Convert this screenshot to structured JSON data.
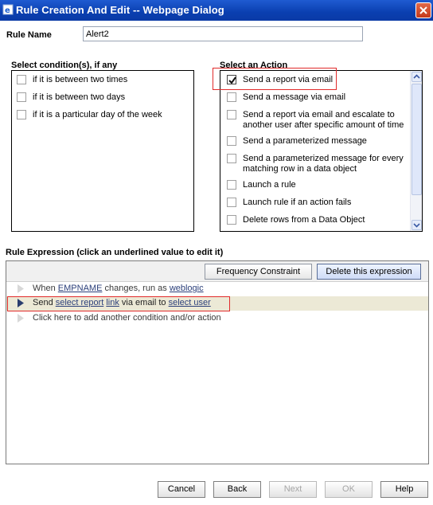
{
  "window": {
    "title": "Rule Creation And Edit -- Webpage Dialog"
  },
  "rule_name": {
    "label": "Rule Name",
    "value": "Alert2"
  },
  "conditions": {
    "label": "Select condition(s), if any",
    "items": [
      {
        "label": "if it is between two times",
        "checked": false
      },
      {
        "label": "if it is between two days",
        "checked": false
      },
      {
        "label": "if it is a particular day of the week",
        "checked": false
      }
    ]
  },
  "actions": {
    "label": "Select an Action",
    "items": [
      {
        "label": "Send a report via email",
        "checked": true
      },
      {
        "label": "Send a message via email",
        "checked": false
      },
      {
        "label": "Send a report via email and escalate to another user after specific amount of time",
        "checked": false
      },
      {
        "label": "Send a parameterized message",
        "checked": false
      },
      {
        "label": "Send a parameterized message for every matching row in a data object",
        "checked": false
      },
      {
        "label": "Launch a rule",
        "checked": false
      },
      {
        "label": "Launch rule if an action fails",
        "checked": false
      },
      {
        "label": "Delete rows from a Data Object",
        "checked": false
      }
    ]
  },
  "expression": {
    "label": "Rule Expression (click an underlined value to edit it)",
    "toolbar": {
      "frequency": "Frequency Constraint",
      "delete": "Delete this expression"
    },
    "row1": {
      "t1": "When ",
      "link1": "EMPNAME",
      "t2": " changes, run as ",
      "link2": "weblogic"
    },
    "row2": {
      "t1": "Send ",
      "link1": "select report",
      "t2": " ",
      "link2": "link",
      "t3": " via email to ",
      "link3": "select user"
    },
    "row3": {
      "text": "Click here to add another condition and/or action"
    }
  },
  "buttons": {
    "cancel": "Cancel",
    "back": "Back",
    "next": "Next",
    "ok": "OK",
    "help": "Help"
  },
  "colors": {
    "titlebar": "#0a3fb0",
    "highlight": "#e12b2b",
    "link": "#2b3f7a",
    "selected_row": "#ece9d6"
  }
}
